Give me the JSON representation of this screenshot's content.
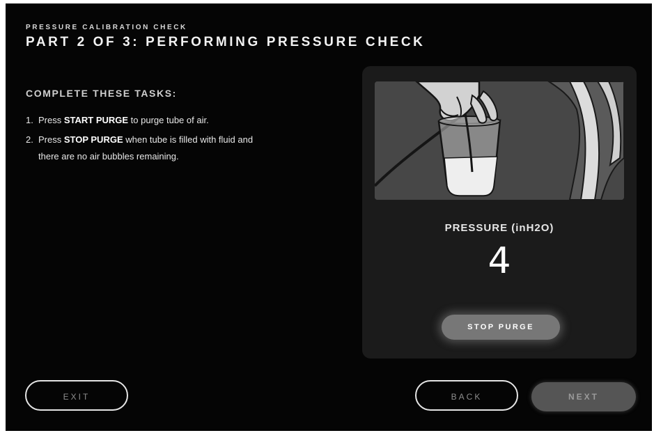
{
  "header": {
    "subtitle": "PRESSURE CALIBRATION CHECK",
    "title": "PART 2 OF 3: PERFORMING PRESSURE CHECK"
  },
  "tasks": {
    "heading": "COMPLETE THESE TASKS:",
    "items": [
      {
        "number": "1.",
        "prefix": "Press ",
        "action": "START PURGE",
        "suffix": " to purge tube of air."
      },
      {
        "number": "2.",
        "prefix": "Press ",
        "action": "STOP PURGE",
        "suffix": " when tube is filled with fluid and",
        "continuation": "there are no air bubbles remaining."
      }
    ]
  },
  "panel": {
    "pressure_label": "PRESSURE (inH2O)",
    "pressure_value": "4",
    "stop_purge_label": "STOP PURGE"
  },
  "footer": {
    "exit_label": "EXIT",
    "back_label": "BACK",
    "next_label": "NEXT"
  },
  "colors": {
    "background": "#050505",
    "panel": "#1b1b1b",
    "illustration_bg": "#444444",
    "next_disabled": "#555555"
  }
}
